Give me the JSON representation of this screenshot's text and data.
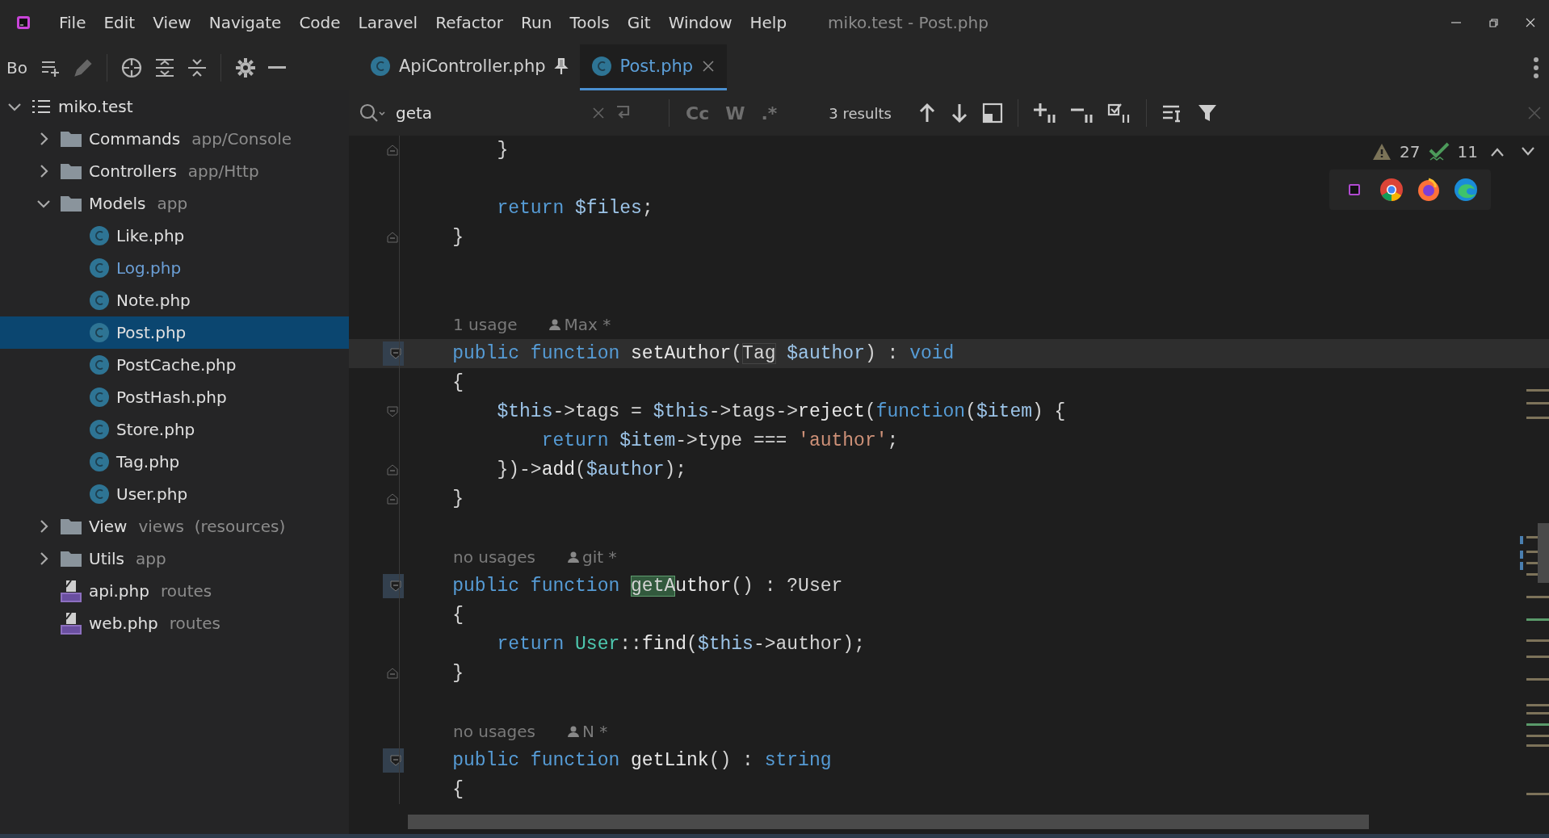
{
  "menu": [
    "File",
    "Edit",
    "View",
    "Navigate",
    "Code",
    "Laravel",
    "Refactor",
    "Run",
    "Tools",
    "Git",
    "Window",
    "Help"
  ],
  "window_title": "miko.test - Post.php",
  "project_panel": {
    "title": "Bo"
  },
  "tabs": [
    {
      "label": "ApiController.php",
      "selected": false,
      "pinned": true
    },
    {
      "label": "Post.php",
      "selected": true,
      "pinned": false
    }
  ],
  "tree": [
    {
      "name": "miko.test",
      "kind": "project",
      "expanded": true,
      "selected": false,
      "children": [
        {
          "name": "Commands",
          "hint": "app/Console",
          "kind": "folder",
          "expanded": false,
          "selected": false
        },
        {
          "name": "Controllers",
          "hint": "app/Http",
          "kind": "folder",
          "expanded": false,
          "selected": false
        },
        {
          "name": "Models",
          "hint": "app",
          "kind": "folder",
          "expanded": true,
          "selected": false,
          "children": [
            {
              "name": "Like.php",
              "kind": "class",
              "selected": false,
              "modified": false
            },
            {
              "name": "Log.php",
              "kind": "class",
              "selected": false,
              "modified": true
            },
            {
              "name": "Note.php",
              "kind": "class",
              "selected": false,
              "modified": false
            },
            {
              "name": "Post.php",
              "kind": "class",
              "selected": true,
              "modified": false
            },
            {
              "name": "PostCache.php",
              "kind": "class",
              "selected": false,
              "modified": false
            },
            {
              "name": "PostHash.php",
              "kind": "class",
              "selected": false,
              "modified": false
            },
            {
              "name": "Store.php",
              "kind": "class",
              "selected": false,
              "modified": false
            },
            {
              "name": "Tag.php",
              "kind": "class",
              "selected": false,
              "modified": false
            },
            {
              "name": "User.php",
              "kind": "class",
              "selected": false,
              "modified": false
            }
          ]
        },
        {
          "name": "View",
          "hint": "views  (resources)",
          "kind": "folder",
          "expanded": false,
          "selected": false
        },
        {
          "name": "Utils",
          "hint": "app",
          "kind": "folder",
          "expanded": false,
          "selected": false
        },
        {
          "name": "api.php",
          "hint": "routes",
          "kind": "php",
          "selected": false
        },
        {
          "name": "web.php",
          "hint": "routes",
          "kind": "php",
          "selected": false
        }
      ]
    }
  ],
  "search": {
    "value": "geta",
    "toggles": [
      {
        "label": "Cc",
        "selected": false
      },
      {
        "label": "W",
        "selected": false
      },
      {
        "label": ".*",
        "selected": false
      }
    ],
    "results": "3 results"
  },
  "inspections": {
    "warnings": "27",
    "weak_warnings": "11"
  },
  "code_lines": [
    {
      "kind": "block_end",
      "current": false,
      "tokens": [
        {
          "text": "        }",
          "kind": "plain"
        }
      ]
    },
    {
      "kind": "blank"
    },
    {
      "kind": "code",
      "current": false,
      "tokens": [
        {
          "text": "        return ",
          "kind": "keyword"
        },
        {
          "text": "$files",
          "kind": "variable"
        },
        {
          "text": ";",
          "kind": "plain"
        }
      ]
    },
    {
      "kind": "block_end",
      "current": false,
      "tokens": [
        {
          "text": "    }",
          "kind": "plain"
        }
      ]
    },
    {
      "kind": "blank"
    },
    {
      "kind": "blank"
    },
    {
      "kind": "inlay",
      "usages": "1 usage",
      "author": "Max *"
    },
    {
      "kind": "method_start",
      "current": true,
      "tokens": [
        {
          "text": "    public function ",
          "kind": "keyword"
        },
        {
          "text": "setAuthor",
          "kind": "function"
        },
        {
          "text": "(",
          "kind": "plain"
        },
        {
          "text": "Tag",
          "kind": "type_ref"
        },
        {
          "text": " $author",
          "kind": "variable"
        },
        {
          "text": ") : ",
          "kind": "plain"
        },
        {
          "text": "void",
          "kind": "keyword"
        }
      ]
    },
    {
      "kind": "code",
      "current": false,
      "tokens": [
        {
          "text": "    {",
          "kind": "plain"
        }
      ]
    },
    {
      "kind": "block_start",
      "current": false,
      "tokens": [
        {
          "text": "        $this",
          "kind": "variable"
        },
        {
          "text": "->tags = ",
          "kind": "plain"
        },
        {
          "text": "$this",
          "kind": "variable"
        },
        {
          "text": "->tags->",
          "kind": "plain"
        },
        {
          "text": "reject",
          "kind": "function"
        },
        {
          "text": "(",
          "kind": "plain"
        },
        {
          "text": "function",
          "kind": "keyword"
        },
        {
          "text": "(",
          "kind": "plain"
        },
        {
          "text": "$item",
          "kind": "variable"
        },
        {
          "text": ") {",
          "kind": "plain"
        }
      ]
    },
    {
      "kind": "code",
      "current": false,
      "tokens": [
        {
          "text": "            return ",
          "kind": "keyword"
        },
        {
          "text": "$item",
          "kind": "variable"
        },
        {
          "text": "->type === ",
          "kind": "plain"
        },
        {
          "text": "'author'",
          "kind": "string"
        },
        {
          "text": ";",
          "kind": "plain"
        }
      ]
    },
    {
      "kind": "block_end",
      "current": false,
      "tokens": [
        {
          "text": "        })->",
          "kind": "plain"
        },
        {
          "text": "add",
          "kind": "function"
        },
        {
          "text": "(",
          "kind": "plain"
        },
        {
          "text": "$author",
          "kind": "variable"
        },
        {
          "text": ");",
          "kind": "plain"
        }
      ]
    },
    {
      "kind": "block_end",
      "current": false,
      "tokens": [
        {
          "text": "    }",
          "kind": "plain"
        }
      ]
    },
    {
      "kind": "blank"
    },
    {
      "kind": "inlay",
      "usages": "no usages",
      "author": "git *"
    },
    {
      "kind": "method_start",
      "current": false,
      "tokens": [
        {
          "text": "    public function ",
          "kind": "keyword"
        },
        {
          "text": "getA",
          "kind": "match"
        },
        {
          "text": "uthor",
          "kind": "function"
        },
        {
          "text": "() : ?",
          "kind": "plain"
        },
        {
          "text": "User",
          "kind": "plain"
        }
      ]
    },
    {
      "kind": "code",
      "current": false,
      "tokens": [
        {
          "text": "    {",
          "kind": "plain"
        }
      ]
    },
    {
      "kind": "code",
      "current": false,
      "tokens": [
        {
          "text": "        return ",
          "kind": "keyword"
        },
        {
          "text": "User",
          "kind": "class"
        },
        {
          "text": "::",
          "kind": "plain"
        },
        {
          "text": "find",
          "kind": "function"
        },
        {
          "text": "(",
          "kind": "plain"
        },
        {
          "text": "$this",
          "kind": "variable"
        },
        {
          "text": "->author);",
          "kind": "plain"
        }
      ]
    },
    {
      "kind": "block_end",
      "current": false,
      "tokens": [
        {
          "text": "    }",
          "kind": "plain"
        }
      ]
    },
    {
      "kind": "blank"
    },
    {
      "kind": "inlay",
      "usages": "no usages",
      "author": "N *"
    },
    {
      "kind": "method_start",
      "current": false,
      "tokens": [
        {
          "text": "    public function ",
          "kind": "keyword"
        },
        {
          "text": "getLink",
          "kind": "function"
        },
        {
          "text": "() : ",
          "kind": "plain"
        },
        {
          "text": "string",
          "kind": "keyword"
        }
      ]
    },
    {
      "kind": "code",
      "current": false,
      "tokens": [
        {
          "text": "    {",
          "kind": "plain"
        }
      ]
    }
  ]
}
